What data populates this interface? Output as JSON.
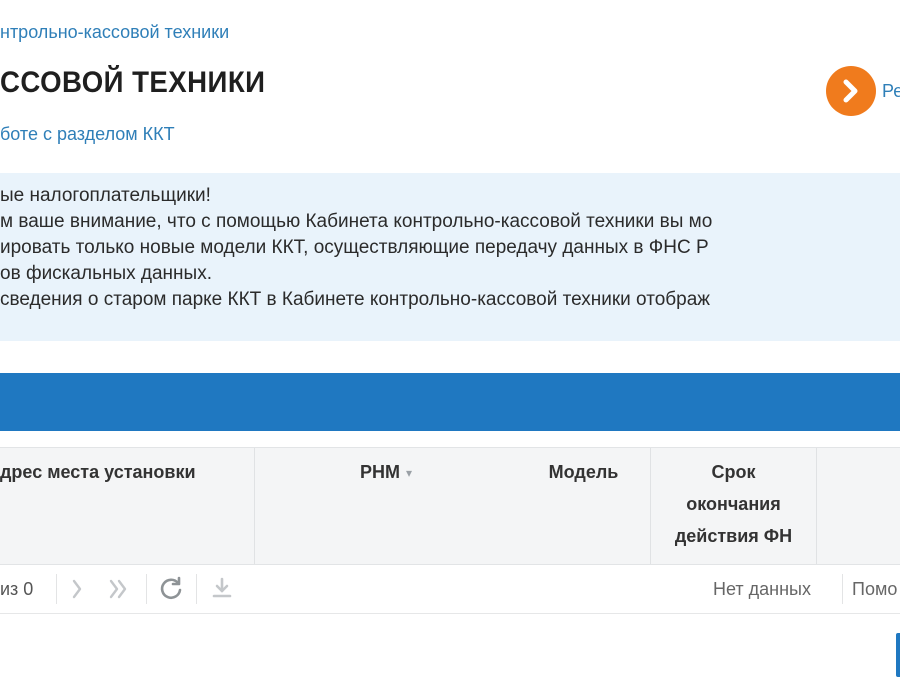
{
  "header": {
    "breadcrumb": "нтрольно-кассовой техники",
    "title": "ССОВОЙ ТЕХНИКИ",
    "help_link": "боте с разделом ККТ",
    "action_label": "Ре"
  },
  "notice": {
    "lines": [
      "ые налогоплательщики!",
      "м ваше внимание, что с помощью Кабинета контрольно-кассовой техники вы мо",
      "ировать только новые модели ККТ, осуществляющие передачу данных в ФНС Р",
      "ов фискальных данных.",
      "сведения о старом парке ККТ в Кабинете контрольно-кассовой техники отображ"
    ]
  },
  "table": {
    "columns": {
      "address": "дрес места установки",
      "rnm": "РНМ",
      "model": "Модель",
      "expiry_1": "Срок",
      "expiry_2": "окончания",
      "expiry_3": "действия ФН"
    },
    "sort_caret": "▾"
  },
  "pager": {
    "of_text": "из 0",
    "status": "Нет данных",
    "help": "Помо"
  },
  "colors": {
    "accent_blue": "#1f78c1",
    "link_blue": "#2f7fb8",
    "action_orange": "#f07b1d",
    "notice_bg": "#e9f3fb"
  },
  "icons": {
    "action": "chevron-right-icon",
    "next": "chevron-right-icon",
    "last": "double-chevron-right-icon",
    "refresh": "refresh-icon",
    "download": "download-icon"
  }
}
